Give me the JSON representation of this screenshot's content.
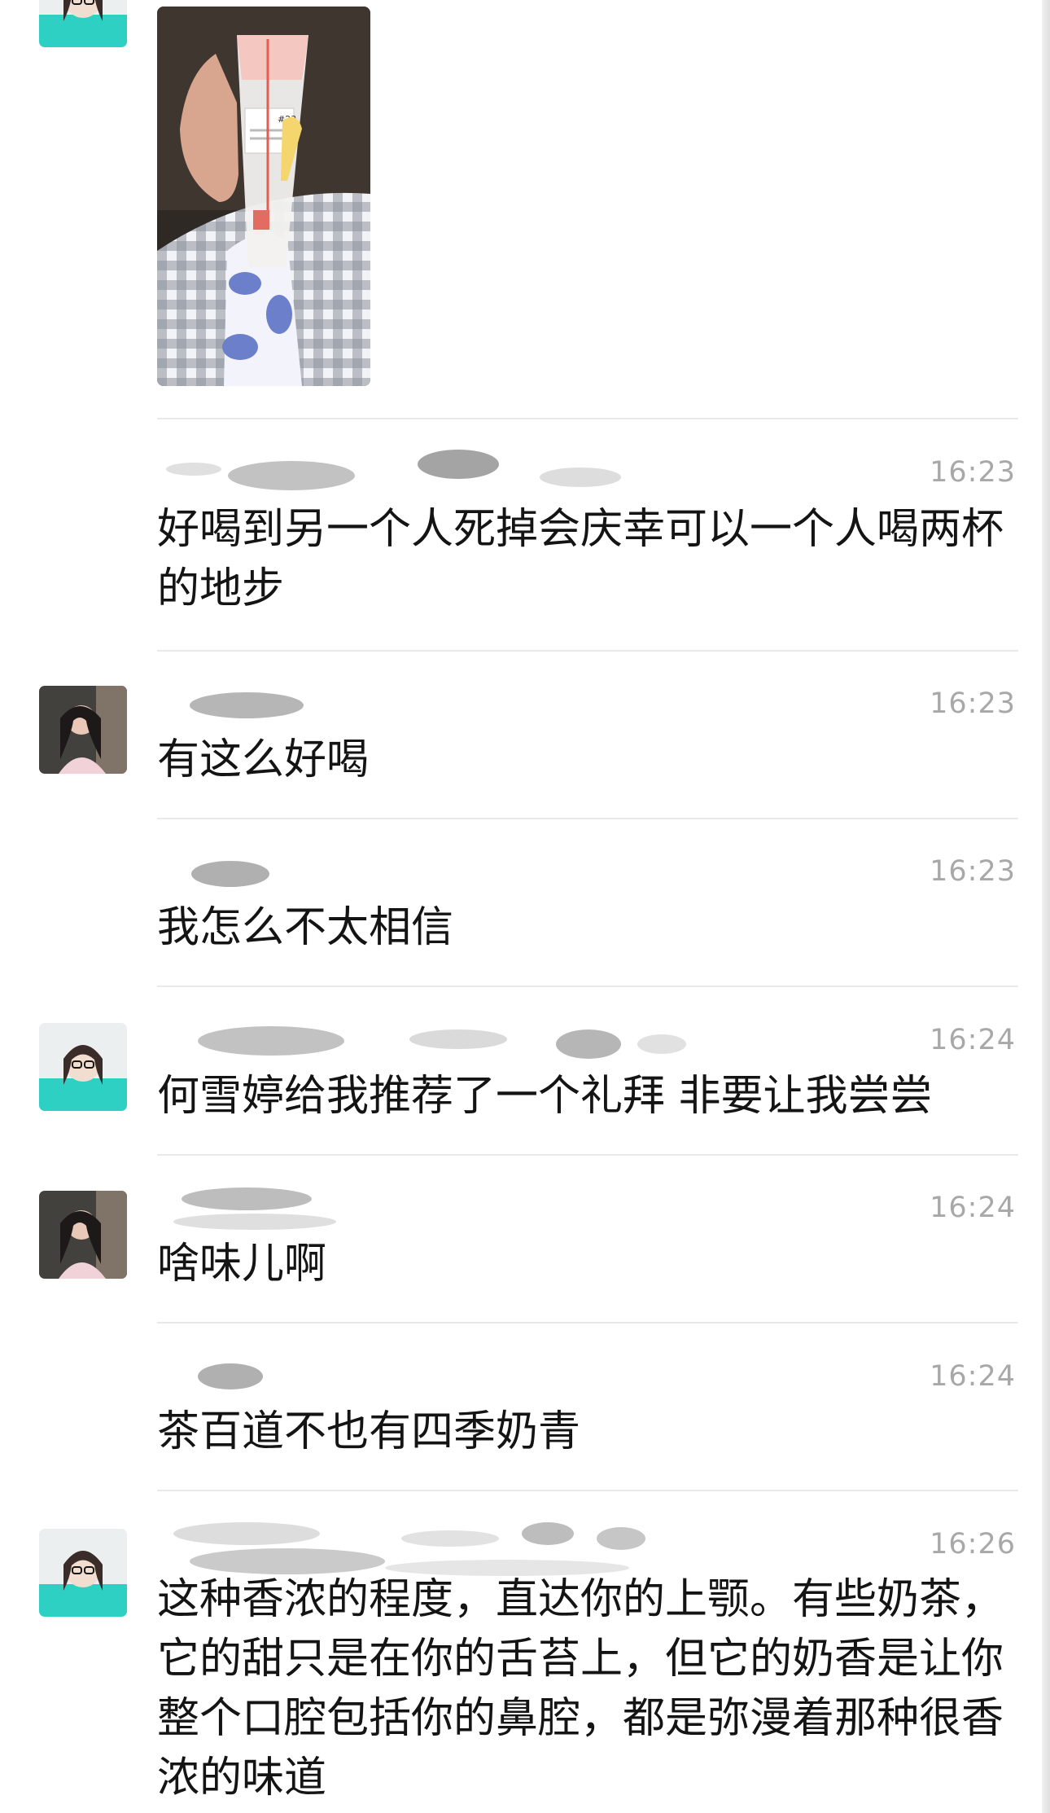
{
  "chat": {
    "messages": [
      {
        "avatar": "teal-hoodie-avatar",
        "type": "image",
        "image_icon": "milk-tea-cup-photo",
        "cup_label": "#23"
      },
      {
        "sender": "",
        "time": "16:23",
        "text": "好喝到另一个人死掉会庆幸可以一个人喝两杯的地步"
      },
      {
        "avatar": "pink-top-avatar",
        "sender": "",
        "time": "16:23",
        "text": "有这么好喝"
      },
      {
        "sender": "",
        "time": "16:23",
        "text": "我怎么不太相信"
      },
      {
        "avatar": "teal-hoodie-avatar",
        "sender": "",
        "time": "16:24",
        "text": "何雪婷给我推荐了一个礼拜 非要让我尝尝"
      },
      {
        "avatar": "pink-top-avatar",
        "sender": "",
        "time": "16:24",
        "text": "啥味儿啊"
      },
      {
        "sender": "",
        "time": "16:24",
        "text": "茶百道不也有四季奶青"
      },
      {
        "avatar": "teal-hoodie-avatar",
        "sender": "",
        "time": "16:26",
        "text": "这种香浓的程度，直达你的上颚。有些奶茶，它的甜只是在你的舌苔上，但它的奶香是让你整个口腔包括你的鼻腔，都是弥漫着那种很香浓的味道"
      }
    ]
  },
  "colors": {
    "text": "#141414",
    "timestamp": "#a8a8a8",
    "divider": "#e9e9e9",
    "avatar_teal": "#27c8bd"
  }
}
